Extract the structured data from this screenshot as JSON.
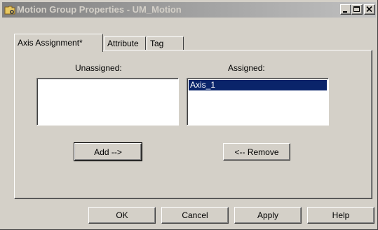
{
  "window": {
    "title": "Motion Group Properties - UM_Motion",
    "minimize_symbol": "_",
    "maximize_symbol": "□",
    "close_symbol": "×"
  },
  "tabs": [
    {
      "label": "Axis Assignment*",
      "active": true
    },
    {
      "label": "Attribute",
      "active": false
    },
    {
      "label": "Tag",
      "active": false
    }
  ],
  "axis_assignment": {
    "unassigned_label": "Unassigned:",
    "assigned_label": "Assigned:",
    "unassigned_items": [],
    "assigned_items": [
      {
        "label": "Axis_1",
        "selected": true
      }
    ],
    "add_label": "Add -->",
    "remove_label": "<-- Remove"
  },
  "footer": {
    "ok_label": "OK",
    "cancel_label": "Cancel",
    "apply_label": "Apply",
    "help_label": "Help"
  },
  "colors": {
    "face": "#d4d0c8",
    "title_inactive_start": "#808080",
    "title_inactive_end": "#c0c0c0",
    "selection": "#0a246a"
  }
}
